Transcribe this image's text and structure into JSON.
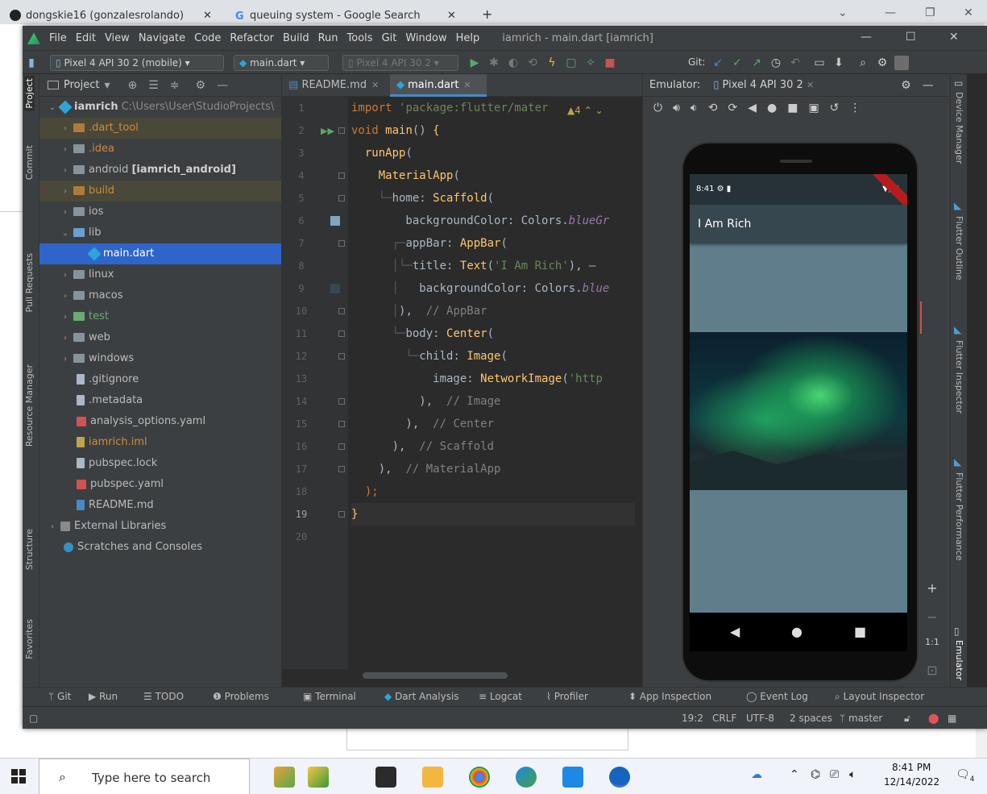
{
  "browser": {
    "tab1": "dongskie16 (gonzalesrolando)",
    "tab2": "queuing system - Google Search",
    "tab_close": "✕",
    "new_tab": "+"
  },
  "window": {
    "menus": [
      "File",
      "Edit",
      "View",
      "Navigate",
      "Code",
      "Refactor",
      "Build",
      "Run",
      "Tools",
      "Git",
      "Window",
      "Help"
    ],
    "title": "iamrich - main.dart [iamrich]"
  },
  "toolbar": {
    "device": "Pixel 4 API 30 2 (mobile)",
    "run_config": "main.dart",
    "target_device": "Pixel 4 API 30 2",
    "git_label": "Git:"
  },
  "left_tabs": [
    "Project",
    "Commit",
    "Pull Requests",
    "Resource Manager",
    "Structure",
    "Favorites"
  ],
  "project": {
    "header": "Project",
    "root_name": "iamrich",
    "root_path": "C:\\Users\\User\\StudioProjects\\",
    "items": [
      {
        "label": ".dart_tool",
        "style": "excluded"
      },
      {
        "label": ".idea",
        "style": "normal"
      },
      {
        "label": "android",
        "suffix": "[iamrich_android]",
        "style": "normal"
      },
      {
        "label": "build",
        "style": "excluded"
      },
      {
        "label": "ios",
        "style": "normal"
      },
      {
        "label": "lib",
        "style": "normal"
      },
      {
        "label": "main.dart",
        "style": "selected"
      },
      {
        "label": "linux",
        "style": "normal"
      },
      {
        "label": "macos",
        "style": "normal"
      },
      {
        "label": "test",
        "style": "normal"
      },
      {
        "label": "web",
        "style": "normal"
      },
      {
        "label": "windows",
        "style": "normal"
      },
      {
        "label": ".gitignore",
        "style": "normal"
      },
      {
        "label": ".metadata",
        "style": "normal"
      },
      {
        "label": "analysis_options.yaml",
        "style": "normal"
      },
      {
        "label": "iamrich.iml",
        "style": "normal"
      },
      {
        "label": "pubspec.lock",
        "style": "normal"
      },
      {
        "label": "pubspec.yaml",
        "style": "normal"
      },
      {
        "label": "README.md",
        "style": "normal"
      },
      {
        "label": "External Libraries",
        "style": "normal"
      },
      {
        "label": "Scratches and Consoles",
        "style": "normal"
      }
    ]
  },
  "editor": {
    "tabs": [
      "README.md",
      "main.dart"
    ],
    "warning_count": "4",
    "line_numbers": [
      "1",
      "2",
      "3",
      "4",
      "5",
      "6",
      "7",
      "8",
      "9",
      "10",
      "11",
      "12",
      "13",
      "14",
      "15",
      "16",
      "17",
      "18",
      "19",
      "20"
    ]
  },
  "emulator": {
    "label": "Emulator:",
    "tab": "Pixel 4 API 30 2",
    "phone_time": "8:41",
    "app_title": "I Am Rich",
    "zoom_in": "+",
    "zoom_out": "−",
    "zoom_reset": "1:1"
  },
  "right_tabs": [
    "Device Manager",
    "Flutter Outline",
    "Flutter Inspector",
    "Flutter Performance",
    "Emulator"
  ],
  "bottom_tools": [
    "Git",
    "Run",
    "TODO",
    "Problems",
    "Terminal",
    "Dart Analysis",
    "Logcat",
    "Profiler",
    "App Inspection",
    "Event Log",
    "Layout Inspector"
  ],
  "status": {
    "position": "19:2",
    "line_sep": "CRLF",
    "encoding": "UTF-8",
    "indent": "2 spaces",
    "branch": "master"
  },
  "taskbar": {
    "search_placeholder": "Type here to search",
    "time": "8:41 PM",
    "date": "12/14/2022",
    "notifications": "4"
  },
  "colors": {
    "ide_bg": "#2b2b2b",
    "panel_bg": "#3c3f41",
    "selection": "#2f65ca",
    "keyword": "#cc7832",
    "function": "#ffc66d",
    "string": "#6a8759",
    "property": "#9876aa",
    "app_bg": "#607d8b"
  }
}
